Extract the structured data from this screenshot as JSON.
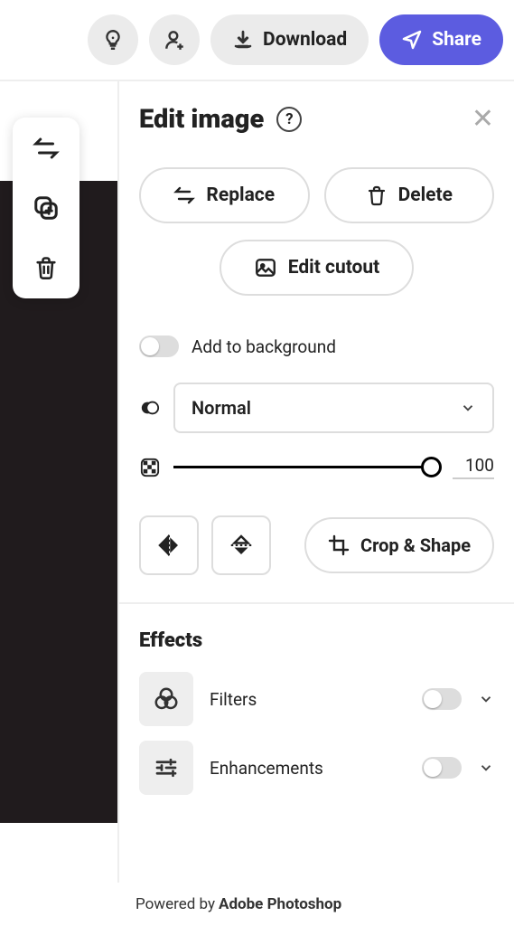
{
  "topbar": {
    "download_label": "Download",
    "share_label": "Share"
  },
  "panel": {
    "title": "Edit image",
    "replace_label": "Replace",
    "delete_label": "Delete",
    "edit_cutout_label": "Edit cutout",
    "add_bg_label": "Add to background",
    "blend_mode": "Normal",
    "opacity_value": "100",
    "crop_shape_label": "Crop & Shape",
    "effects_title": "Effects",
    "filters_label": "Filters",
    "enhancements_label": "Enhancements"
  },
  "footer": {
    "prefix": "Powered by",
    "brand": "Adobe Photoshop"
  }
}
